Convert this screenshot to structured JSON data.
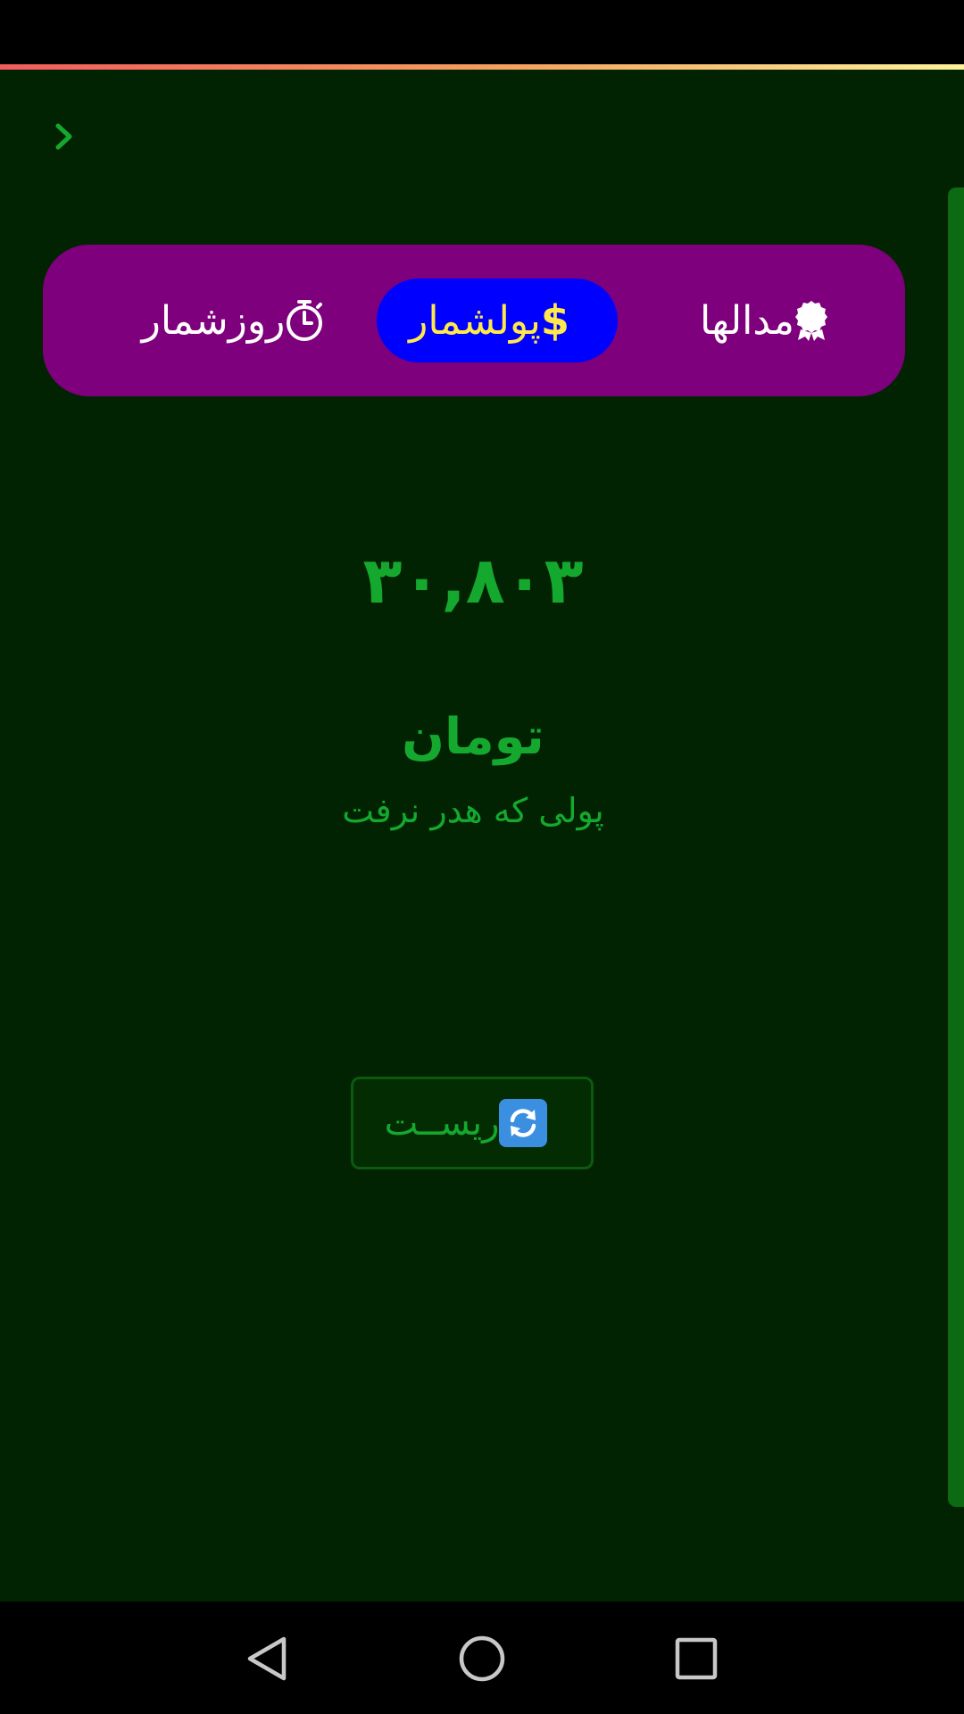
{
  "tabs": {
    "medals": {
      "label": "مدالها",
      "icon": "medal-icon"
    },
    "money": {
      "label": "پولشمار",
      "icon": "dollar-icon",
      "symbol": "$",
      "active": true
    },
    "days": {
      "label": "روزشمار",
      "icon": "stopwatch-icon"
    }
  },
  "main": {
    "amount": "۳۰,۸۰۳",
    "currency": "تومان",
    "subtitle": "پولی که هدر نرفت"
  },
  "reset": {
    "label": "ریســت",
    "icon": "refresh-icon"
  },
  "navigation": {
    "back": "chevron-right-icon",
    "system": [
      "back-triangle-icon",
      "home-circle-icon",
      "recents-square-icon"
    ]
  },
  "colors": {
    "background": "#022301",
    "tabbar": "#7e007c",
    "active_tab": "#0000ff",
    "active_tab_text": "#ffe94a",
    "accent_green": "#15a82f",
    "scrollbar": "#0b6a12"
  }
}
